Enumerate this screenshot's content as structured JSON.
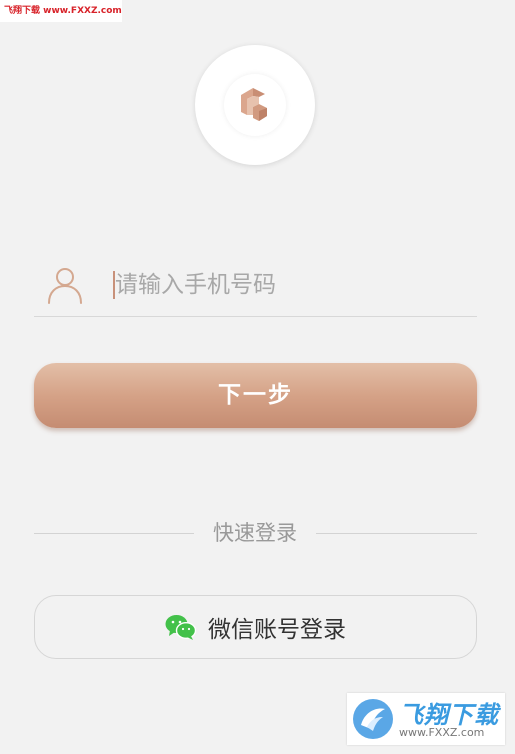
{
  "watermark_top": {
    "text": "飞翔下载 www.FXXZ.com"
  },
  "logo": {
    "icon": "brand-logo-icon",
    "color": "#d9a58c"
  },
  "phone": {
    "placeholder": "请输入手机号码",
    "value": ""
  },
  "next_button": {
    "label": "下一步"
  },
  "quick_login": {
    "title": "快速登录",
    "wechat_label": "微信账号登录",
    "wechat_icon": "wechat-icon",
    "wechat_color": "#43c14a"
  },
  "watermark_bottom": {
    "title": "飞翔下载",
    "url": "www.FXXZ.com"
  },
  "colors": {
    "accent": "#d5a287",
    "background": "#f2f2f2"
  }
}
